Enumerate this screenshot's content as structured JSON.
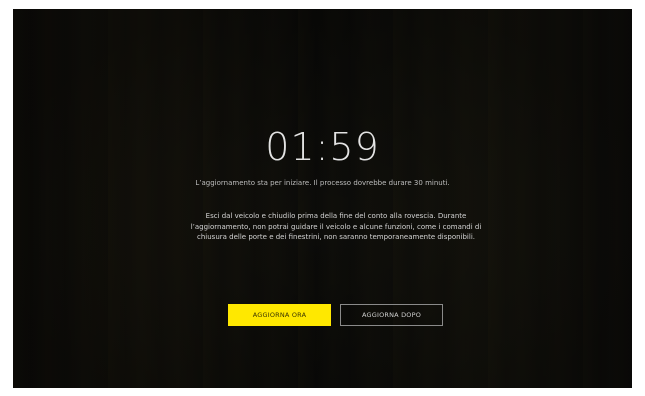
{
  "countdown": {
    "time": "01:59"
  },
  "update": {
    "subtitle": "L’aggiornamento sta per iniziare. Il processo dovrebbe durare 30 minuti.",
    "message": "Esci dal veicolo e chiudilo prima della fine del conto alla rovescia. Durante l’aggiornamento, non potrai guidare il veicolo e alcune funzioni, come i comandi di chiusura delle porte e dei finestrini, non saranno temporaneamente disponibili."
  },
  "actions": {
    "update_now_label": "AGGIORNA ORA",
    "update_later_label": "AGGIORNA DOPO"
  },
  "colors": {
    "accent": "#ffe800",
    "background": "#0d0c09"
  }
}
